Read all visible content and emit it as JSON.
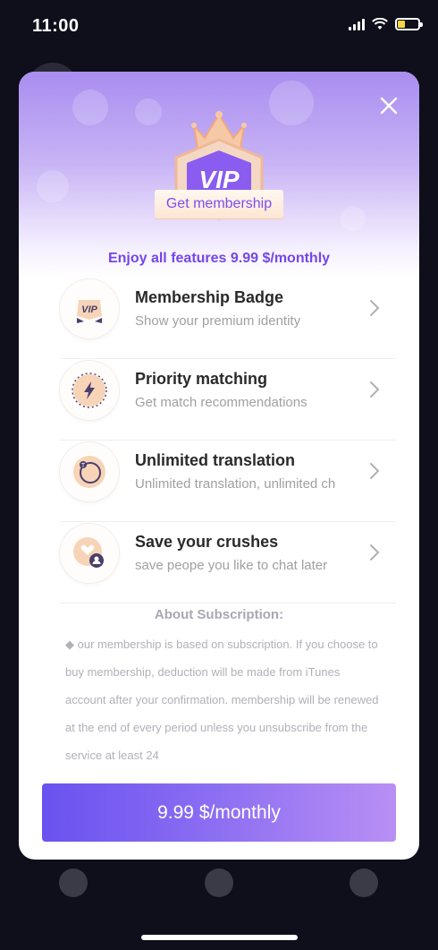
{
  "status_bar": {
    "time": "11:00"
  },
  "modal": {
    "badge_text": "VIP",
    "get_membership": "Get membership",
    "enjoy_text": "Enjoy all features 9.99 $/monthly",
    "features": [
      {
        "title": "Membership Badge",
        "subtitle": "Show your premium identity",
        "icon": "vip-badge-icon"
      },
      {
        "title": "Priority matching",
        "subtitle": "Get match recommendations",
        "icon": "lightning-icon"
      },
      {
        "title": "Unlimited translation",
        "subtitle": "Unlimited translation, unlimited ch",
        "icon": "translate-icon"
      },
      {
        "title": "Save your crushes",
        "subtitle": "save peope you like to chat later",
        "icon": "heart-user-icon"
      }
    ],
    "about": {
      "title": "About Subscription:",
      "body": "◆ our membership is based on subscription. If you choose to buy membership, deduction will be made from iTunes account after your confirmation. membership will be renewed at the end of every period unless you unsubscribe from the service at least 24"
    },
    "cta_label": "9.99 $/monthly"
  },
  "colors": {
    "accent": "#7447e8",
    "cta_start": "#6a52f0",
    "cta_end": "#b98ff4",
    "background": "#0e0f1a"
  }
}
